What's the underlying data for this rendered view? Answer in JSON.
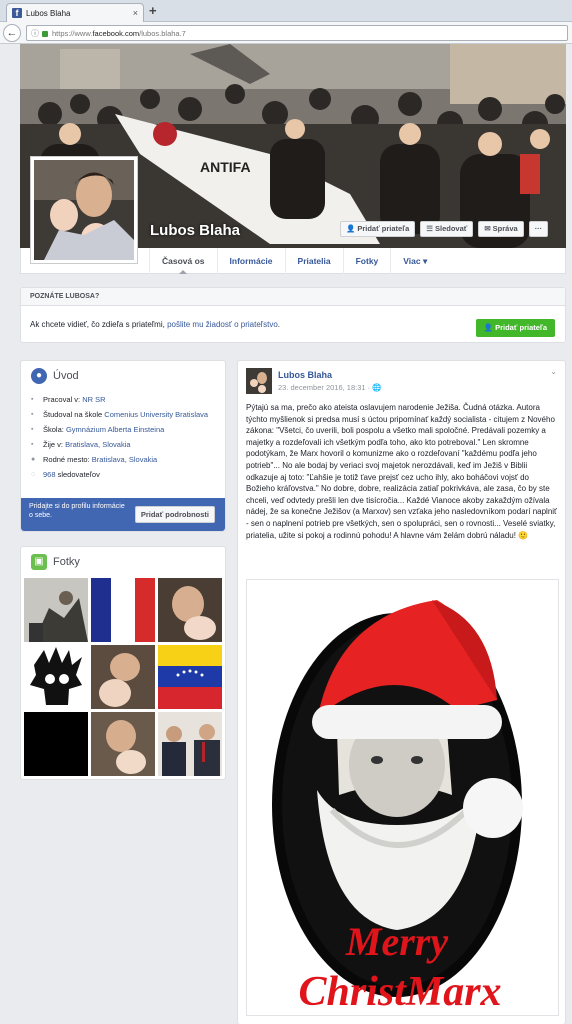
{
  "browser": {
    "tab_title": "Lubos Blaha",
    "tab_close": "×",
    "new_tab": "+",
    "url_prefix": "https://www.",
    "url_domain": "facebook.com",
    "url_path": "/lubos.blaha.7"
  },
  "profile": {
    "name": "Lubos Blaha",
    "actions": {
      "add_friend": "Pridať priateľa",
      "follow": "Sledovať",
      "message": "Správa",
      "more": "···"
    },
    "tabs": [
      "Časová os",
      "Informácie",
      "Priatelia",
      "Fotky",
      "Viac ▾"
    ]
  },
  "know_banner": {
    "heading": "POZNÁTE LUBOSA?",
    "text_before": "Ak chcete vidieť, čo zdieľa s priateľmi, ",
    "link": "pošlite mu žiadosť o priateľstvo",
    "text_after": ".",
    "button": "Pridať priateľa"
  },
  "intro": {
    "title": "Úvod",
    "items": [
      {
        "prefix": "Pracoval v: ",
        "link": "NR SR",
        "suffix": ""
      },
      {
        "prefix": "Študoval na škole ",
        "link": "Comenius University Bratislava",
        "suffix": ""
      },
      {
        "prefix": "Škola: ",
        "link": "Gymnázium Alberta Einsteina",
        "suffix": ""
      },
      {
        "prefix": "Žije v: ",
        "link": "Bratislava, Slovakia",
        "suffix": ""
      },
      {
        "prefix": "Rodné mesto: ",
        "link": "Bratislava, Slovakia",
        "suffix": ""
      },
      {
        "prefix": "",
        "link": "968",
        "suffix": " sledovateľov"
      }
    ],
    "footer_text": "Pridajte si do profilu informácie o sebe.",
    "footer_button": "Pridať podrobnosti"
  },
  "photos": {
    "title": "Fotky"
  },
  "post": {
    "author": "Lubos Blaha",
    "date": "23. december 2016, 18:31",
    "text": "Pýtajú sa ma, prečo ako ateista oslavujem narodenie Ježiša. Čudná otázka. Autora týchto myšlienok si predsa musí s úctou pripomínať každý socialista - citujem z Nového zákona: \"Všetci, čo uverili, boli pospolu a všetko mali spoločné. Predávali pozemky a majetky a rozdeľovali ich všetkým podľa toho, ako kto potreboval.\" Len skromne podotýkam, že Marx hovoril o komunizme ako o rozdeľovaní \"každému podľa jeho potrieb\"... No ale bodaj by veriaci svoj majetok nerozdávali, keď im Ježiš v Biblii odkazuje aj toto: \"Ľahšie je totiž ťave prejsť cez ucho ihly, ako boháčovi vojsť do Božieho kráľovstva.\" No dobre, dobre, realizácia zatiaľ pokrivkáva, ale zasa, čo by ste chceli, veď odvtedy prešli len dve tisícročia... Každé Vianoce akoby zakaždým ožívala nádej, že sa konečne Ježišov (a Marxov) sen vzťaka jeho nasledovníkom podarí naplniť - sen o naplnení potrieb pre všetkých, sen o spolupráci, sen o rovnosti... Veselé sviatky, priatelia, užite si pokoj a rodinnú pohodu! A hlavne vám želám dobrú náladu! 🙂",
    "image_caption_line1": "Merry",
    "image_caption_line2": "ChristMarx"
  },
  "colors": {
    "facebook_blue": "#4267b2",
    "link_blue": "#365899",
    "green_button": "#42b72a",
    "caption_red": "#e0141b"
  }
}
